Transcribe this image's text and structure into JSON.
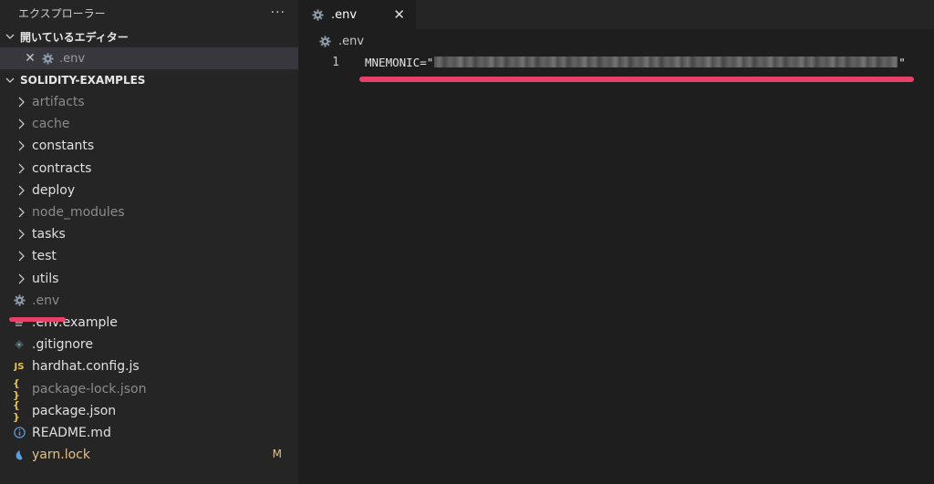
{
  "explorer": {
    "title": "エクスプローラー",
    "more_label": "···"
  },
  "open_editors": {
    "section_label": "開いているエディター",
    "items": [
      {
        "name": ".env"
      }
    ]
  },
  "workspace": {
    "section_label": "SOLIDITY-EXAMPLES",
    "folders": [
      {
        "label": "artifacts",
        "dim": true
      },
      {
        "label": "cache",
        "dim": true
      },
      {
        "label": "constants",
        "dim": false
      },
      {
        "label": "contracts",
        "dim": false
      },
      {
        "label": "deploy",
        "dim": false
      },
      {
        "label": "node_modules",
        "dim": true
      },
      {
        "label": "tasks",
        "dim": false
      },
      {
        "label": "test",
        "dim": false
      },
      {
        "label": "utils",
        "dim": false
      }
    ],
    "files": [
      {
        "label": ".env",
        "icon": "gear-icon",
        "dim": true
      },
      {
        "label": ".env.example",
        "icon": "lines-icon",
        "dim": false
      },
      {
        "label": ".gitignore",
        "icon": "diamond-icon",
        "dim": false
      },
      {
        "label": "hardhat.config.js",
        "icon": "js-icon",
        "dim": false
      },
      {
        "label": "package-lock.json",
        "icon": "braces-icon",
        "dim": true
      },
      {
        "label": "package.json",
        "icon": "braces-icon",
        "dim": false
      },
      {
        "label": "README.md",
        "icon": "info-icon",
        "dim": false
      },
      {
        "label": "yarn.lock",
        "icon": "yarn-icon",
        "dim": false,
        "badge": "M"
      }
    ]
  },
  "editor": {
    "tab_label": ".env",
    "breadcrumb": ".env",
    "line_number": "1",
    "code_prefix": "MNEMONIC=\"",
    "code_suffix": "\""
  },
  "colors": {
    "highlight": "#e7416a",
    "modified": "#e2c08d",
    "js": "#e8c34a",
    "info": "#5aa0e0"
  }
}
